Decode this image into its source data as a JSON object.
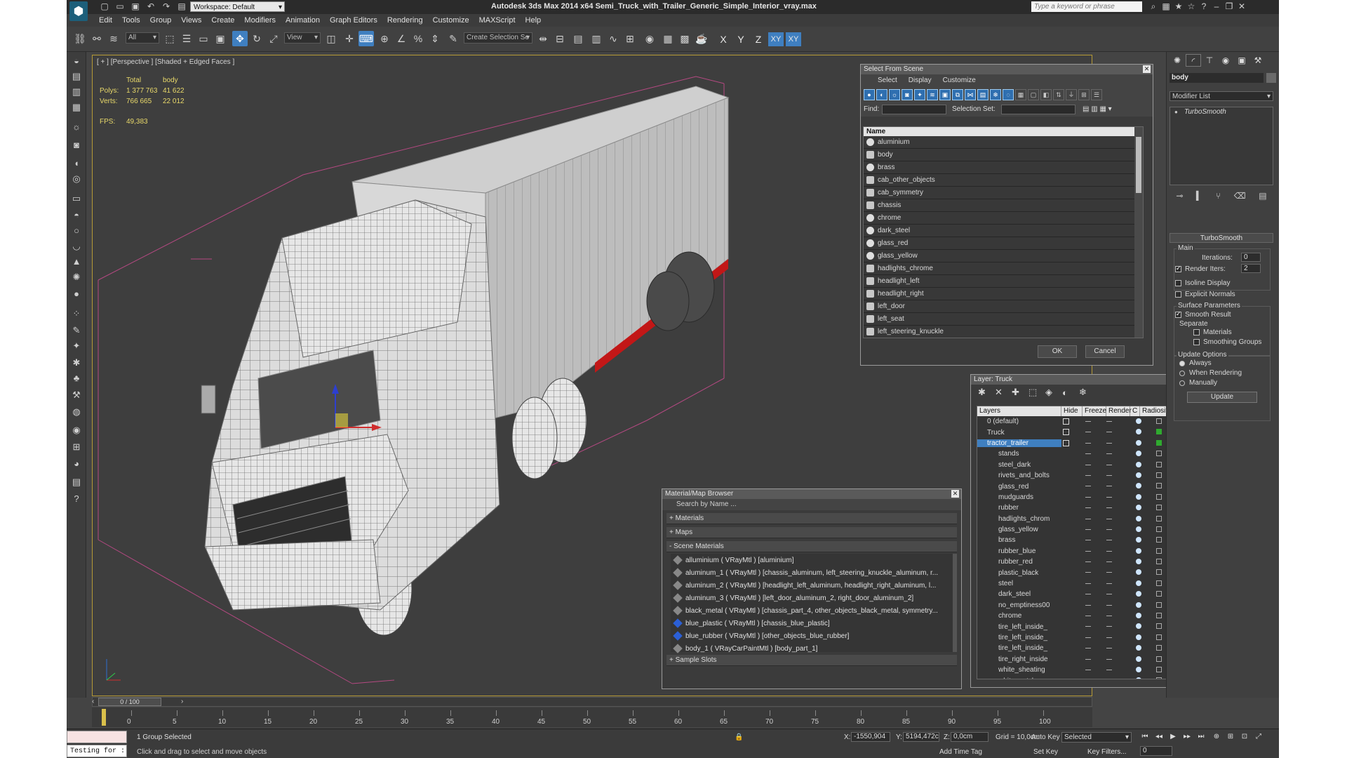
{
  "titlebar": {
    "workspace": "Workspace: Default",
    "title": "Autodesk 3ds Max  2014 x64     Semi_Truck_with_Trailer_Generic_Simple_Interior_vray.max",
    "search_placeholder": "Type a keyword or phrase"
  },
  "menu": [
    "Edit",
    "Tools",
    "Group",
    "Views",
    "Create",
    "Modifiers",
    "Animation",
    "Graph Editors",
    "Rendering",
    "Customize",
    "MAXScript",
    "Help"
  ],
  "toolbar": {
    "selection_filter": "All",
    "ref_coord": "View",
    "named_selection": "Create Selection Se",
    "axes": [
      "X",
      "Y",
      "Z",
      "XY",
      "XY"
    ]
  },
  "viewport": {
    "label": "[ + ] [Perspective ] [Shaded + Edged Faces ]",
    "stats": {
      "col_total": "Total",
      "col_body": "body",
      "polys_label": "Polys:",
      "polys_total": "1 377 763",
      "polys_body": "41 622",
      "verts_label": "Verts:",
      "verts_total": "766 665",
      "verts_body": "22 012",
      "fps_label": "FPS:",
      "fps_value": "49,383"
    }
  },
  "select_from_scene": {
    "title": "Select From Scene",
    "tabs": [
      "Select",
      "Display",
      "Customize"
    ],
    "find_label": "Find:",
    "selection_set_label": "Selection Set:",
    "column_name": "Name",
    "items": [
      "aluminium",
      "body",
      "brass",
      "cab_other_objects",
      "cab_symmetry",
      "chassis",
      "chrome",
      "dark_steel",
      "glass_red",
      "glass_yellow",
      "hadlights_chrome",
      "headlight_left",
      "headlight_right",
      "left_door",
      "left_seat",
      "left_steering_knuckle"
    ],
    "ok_label": "OK",
    "cancel_label": "Cancel"
  },
  "layer_manager": {
    "title": "Layer: Truck",
    "columns": [
      "Layers",
      "Hide",
      "Freeze",
      "Render",
      "C",
      "Radiosity"
    ],
    "rows": [
      {
        "name": "0 (default)",
        "indent": 1,
        "green": false,
        "selected": false
      },
      {
        "name": "Truck",
        "indent": 1,
        "green": true,
        "selected": false
      },
      {
        "name": "tractor_trailer",
        "indent": 1,
        "green": true,
        "selected": true
      },
      {
        "name": "stands",
        "indent": 2,
        "green": false,
        "selected": false
      },
      {
        "name": "steel_dark",
        "indent": 2,
        "green": false,
        "selected": false
      },
      {
        "name": "rivets_and_bolts",
        "indent": 2,
        "green": false,
        "selected": false
      },
      {
        "name": "glass_red",
        "indent": 2,
        "green": false,
        "selected": false
      },
      {
        "name": "mudguards",
        "indent": 2,
        "green": false,
        "selected": false
      },
      {
        "name": "rubber",
        "indent": 2,
        "green": false,
        "selected": false
      },
      {
        "name": "hadlights_chrom",
        "indent": 2,
        "green": false,
        "selected": false
      },
      {
        "name": "glass_yellow",
        "indent": 2,
        "green": false,
        "selected": false
      },
      {
        "name": "brass",
        "indent": 2,
        "green": false,
        "selected": false
      },
      {
        "name": "rubber_blue",
        "indent": 2,
        "green": false,
        "selected": false
      },
      {
        "name": "rubber_red",
        "indent": 2,
        "green": false,
        "selected": false
      },
      {
        "name": "plastic_black",
        "indent": 2,
        "green": false,
        "selected": false
      },
      {
        "name": "steel",
        "indent": 2,
        "green": false,
        "selected": false
      },
      {
        "name": "dark_steel",
        "indent": 2,
        "green": false,
        "selected": false
      },
      {
        "name": "no_emptiness00",
        "indent": 2,
        "green": false,
        "selected": false
      },
      {
        "name": "chrome",
        "indent": 2,
        "green": false,
        "selected": false
      },
      {
        "name": "tire_left_inside_",
        "indent": 2,
        "green": false,
        "selected": false
      },
      {
        "name": "tire_left_inside_",
        "indent": 2,
        "green": false,
        "selected": false
      },
      {
        "name": "tire_left_inside_",
        "indent": 2,
        "green": false,
        "selected": false
      },
      {
        "name": "tire_right_inside",
        "indent": 2,
        "green": false,
        "selected": false
      },
      {
        "name": "white_sheating",
        "indent": 2,
        "green": false,
        "selected": false
      },
      {
        "name": "white_patch",
        "indent": 2,
        "green": false,
        "selected": false
      }
    ]
  },
  "material_browser": {
    "title": "Material/Map Browser",
    "search_placeholder": "Search by Name ...",
    "sections": {
      "materials": "+ Materials",
      "maps": "+ Maps",
      "scene_materials": "- Scene Materials",
      "sample_slots": "+ Sample Slots"
    },
    "scene_materials": [
      {
        "text": "alluminium  ( VRayMtl )  [aluminium]",
        "blue": false
      },
      {
        "text": "aluminum_1  ( VRayMtl )  [chassis_aluminum, left_steering_knuckle_aluminum, r...",
        "blue": false
      },
      {
        "text": "aluminum_2  ( VRayMtl )  [headlight_left_aluminum, headlight_right_aluminum, l...",
        "blue": false
      },
      {
        "text": "aluminum_3  ( VRayMtl )  [left_door_aluminum_2, right_door_aluminum_2]",
        "blue": false
      },
      {
        "text": "black_metal  ( VRayMtl )  [chassis_part_4, other_objects_black_metal, symmetry...",
        "blue": false
      },
      {
        "text": "blue_plastic  ( VRayMtl )  [chassis_blue_plastic]",
        "blue": true
      },
      {
        "text": "blue_rubber  ( VRayMtl )  [other_objects_blue_rubber]",
        "blue": true
      },
      {
        "text": "body_1  ( VRayCarPaintMtl )  [body_part_1]",
        "blue": false
      }
    ]
  },
  "command_panel": {
    "object_name": "body",
    "modifier_list": "Modifier List",
    "stack_item": "TurboSmooth",
    "rollout_title": "TurboSmooth",
    "main_label": "Main",
    "iterations_label": "Iterations:",
    "iterations_value": "0",
    "render_iters_label": "Render Iters:",
    "render_iters_value": "2",
    "isoline_label": "Isoline Display",
    "explicit_normals_label": "Explicit Normals",
    "surface_params_label": "Surface Parameters",
    "smooth_result_label": "Smooth Result",
    "separate_label": "Separate",
    "materials_label": "Materials",
    "smoothing_groups_label": "Smoothing Groups",
    "update_options_label": "Update Options",
    "always_label": "Always",
    "when_rendering_label": "When Rendering",
    "manually_label": "Manually",
    "update_button": "Update"
  },
  "timeslider": {
    "position": "0 / 100",
    "ticks": [
      "0",
      "5",
      "10",
      "15",
      "20",
      "25",
      "30",
      "35",
      "40",
      "45",
      "50",
      "55",
      "60",
      "65",
      "70",
      "75",
      "80",
      "85",
      "90",
      "95",
      "100"
    ]
  },
  "statusbar": {
    "maxscript_line1": "",
    "maxscript_line2": "Testing for :",
    "selection": "1 Group Selected",
    "prompt": "Click and drag to select and move objects",
    "x_label": "X:",
    "x_value": "-1550,904",
    "y_label": "Y:",
    "y_value": "5194,472c",
    "z_label": "Z:",
    "z_value": "0,0cm",
    "grid": "Grid = 10,0cm",
    "add_time_tag": "Add Time Tag",
    "auto_key": "Auto Key",
    "selected_dropdown": "Selected",
    "set_key": "Set Key",
    "key_filters": "Key Filters...",
    "frame": "0"
  }
}
